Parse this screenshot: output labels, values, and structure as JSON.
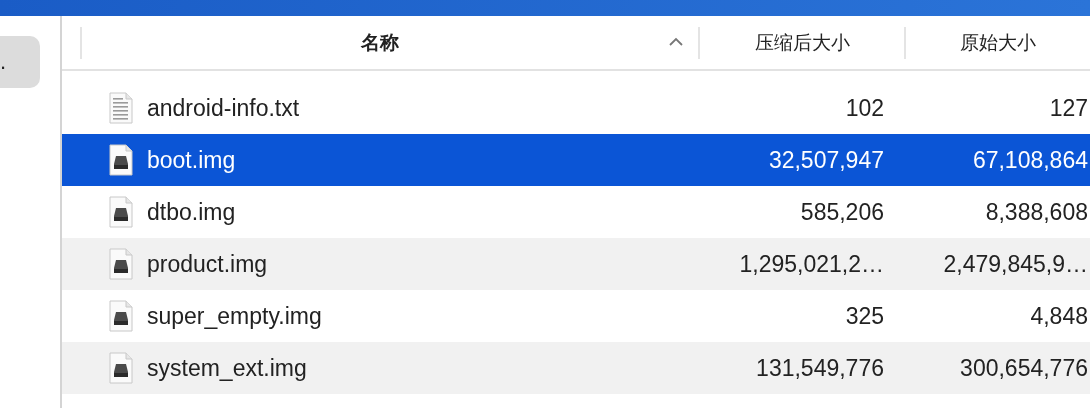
{
  "sidebar": {
    "items": [
      {
        "label": ".",
        "selected": true
      }
    ]
  },
  "table": {
    "columns": [
      {
        "label": "名称",
        "sorted": true
      },
      {
        "label": "压缩后大小",
        "sorted": false
      },
      {
        "label": "原始大小",
        "sorted": false
      }
    ],
    "rows": [
      {
        "name": "android-info.txt",
        "kind": "text",
        "compressed": "102",
        "original": "127",
        "selected": false
      },
      {
        "name": "boot.img",
        "kind": "image",
        "compressed": "32,507,947",
        "original": "67,108,864",
        "selected": true
      },
      {
        "name": "dtbo.img",
        "kind": "image",
        "compressed": "585,206",
        "original": "8,388,608",
        "selected": false
      },
      {
        "name": "product.img",
        "kind": "image",
        "compressed": "1,295,021,2…",
        "original": "2,479,845,9…",
        "selected": false
      },
      {
        "name": "super_empty.img",
        "kind": "image",
        "compressed": "325",
        "original": "4,848",
        "selected": false
      },
      {
        "name": "system_ext.img",
        "kind": "image",
        "compressed": "131,549,776",
        "original": "300,654,776",
        "selected": false
      }
    ]
  }
}
